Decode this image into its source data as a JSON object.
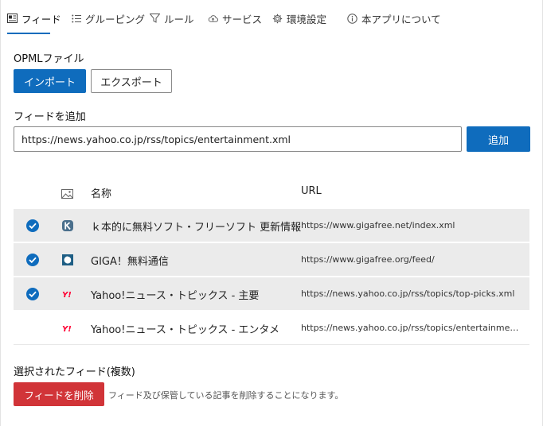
{
  "tabs": [
    {
      "label": "フィード",
      "icon": "feed-icon"
    },
    {
      "label": "グルーピング",
      "icon": "list-icon"
    },
    {
      "label": "ルール",
      "icon": "filter-icon"
    },
    {
      "label": "サービス",
      "icon": "cloud-icon"
    },
    {
      "label": "環境設定",
      "icon": "gear-icon"
    },
    {
      "label": "本アプリについて",
      "icon": "info-icon"
    }
  ],
  "opml": {
    "label": "OPMLファイル",
    "import_label": "インポート",
    "export_label": "エクスポート"
  },
  "add_feed": {
    "label": "フィードを追加",
    "url_value": "https://news.yahoo.co.jp/rss/topics/entertainment.xml",
    "add_label": "追加"
  },
  "table": {
    "col_icon": "image-icon",
    "col_name": "名称",
    "col_url": "URL",
    "rows": [
      {
        "selected": true,
        "icon": "gigafree-k-icon",
        "name": "ｋ本的に無料ソフト・フリーソフト 更新情報",
        "url": "https://www.gigafree.net/index.xml"
      },
      {
        "selected": true,
        "icon": "gigafree-org-icon",
        "name": "GIGA！無料通信",
        "url": "https://www.gigafree.org/feed/"
      },
      {
        "selected": true,
        "icon": "yahoo-icon",
        "name": "Yahoo!ニュース・トピックス - 主要",
        "url": "https://news.yahoo.co.jp/rss/topics/top-picks.xml"
      },
      {
        "selected": false,
        "icon": "yahoo-icon",
        "name": "Yahoo!ニュース・トピックス - エンタメ",
        "url": "https://news.yahoo.co.jp/rss/topics/entertainment.xml"
      }
    ]
  },
  "selection": {
    "label": "選択されたフィード(複数)",
    "delete_label": "フィードを削除",
    "note": "フィード及び保管している記事を削除することになります。"
  },
  "colors": {
    "accent": "#0f6cbd",
    "danger": "#d13438",
    "selected_row": "#ebebeb"
  }
}
